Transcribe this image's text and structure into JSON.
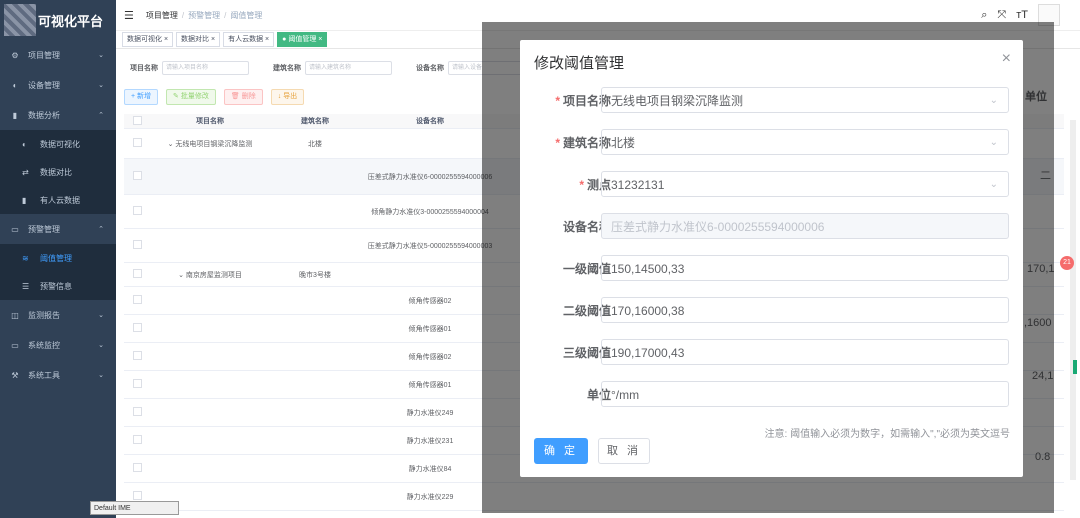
{
  "app": {
    "title": "可视化平台"
  },
  "sidebar": {
    "items": [
      {
        "label": "项目管理",
        "icon": "gear-icon"
      },
      {
        "label": "设备管理",
        "icon": "dashboard-icon"
      },
      {
        "label": "数据分析",
        "icon": "chart-icon"
      }
    ],
    "data_sub": [
      {
        "label": "数据可视化",
        "icon": "dashboard-icon"
      },
      {
        "label": "数据对比",
        "icon": "compare-icon"
      },
      {
        "label": "有人云数据",
        "icon": "chart-icon"
      }
    ],
    "alarm": {
      "label": "预警管理",
      "icon": "monitor-icon"
    },
    "alarm_sub": [
      {
        "label": "阈值管理",
        "icon": "threshold-icon"
      },
      {
        "label": "预警信息",
        "icon": "list-icon"
      }
    ],
    "bottom": [
      {
        "label": "监测报告",
        "icon": "book-icon"
      },
      {
        "label": "系统监控",
        "icon": "monitor-icon"
      },
      {
        "label": "系统工具",
        "icon": "wrench-icon"
      }
    ]
  },
  "breadcrumb": [
    "项目管理",
    "预警管理",
    "阈值管理"
  ],
  "tags": [
    "数据可视化",
    "数据对比",
    "有人云数据",
    "阈值管理"
  ],
  "filters": {
    "project_label": "项目名称",
    "project_ph": "请输入项目名称",
    "building_label": "建筑名称",
    "building_ph": "请输入建筑名称",
    "device_label": "设备名称",
    "device_ph": "请输入设备"
  },
  "toolbar": {
    "add": "新增",
    "batch": "批量修改",
    "delete": "删除",
    "export": "导出"
  },
  "table": {
    "headers": [
      "项目名称",
      "建筑名称",
      "设备名称"
    ],
    "rows": [
      {
        "project": "无线电项目钢梁沉降监测",
        "building": "北楼",
        "device": ""
      },
      {
        "project": "",
        "building": "",
        "device": "压差式静力水准仪6-0000255594000006"
      },
      {
        "project": "",
        "building": "",
        "device": "倾角静力水准仪3-0000255594000004"
      },
      {
        "project": "",
        "building": "",
        "device": "压差式静力水准仪5-0000255594000003"
      },
      {
        "project": "南京房屋监测项目",
        "building": "晚市3号楼",
        "device": ""
      },
      {
        "project": "",
        "building": "",
        "device": "倾角传感器02"
      },
      {
        "project": "",
        "building": "",
        "device": "倾角传感器01"
      },
      {
        "project": "",
        "building": "",
        "device": "倾角传感器02"
      },
      {
        "project": "",
        "building": "",
        "device": "倾角传感器01"
      },
      {
        "project": "",
        "building": "",
        "device": "静力水准仪249"
      },
      {
        "project": "",
        "building": "",
        "device": "静力水准仪231"
      },
      {
        "project": "",
        "building": "",
        "device": "静力水准仪84"
      },
      {
        "project": "",
        "building": "",
        "device": "静力水准仪229"
      }
    ]
  },
  "background_right": {
    "col": "单位",
    "v1": "二",
    "v2": "170,1",
    "v3": ",1600",
    "v4": "24,1",
    "v5": "0.8",
    "badge": "21"
  },
  "dialog": {
    "title": "修改阈值管理",
    "fields": {
      "project_label": "项目名称",
      "project_value": "无线电项目钢梁沉降监测",
      "building_label": "建筑名称",
      "building_value": "北楼",
      "point_label": "测点",
      "point_value": "31232131",
      "device_label": "设备名称",
      "device_value": "压差式静力水准仪6-0000255594000006",
      "level1_label": "一级阈值",
      "level1_value": "150,14500,33",
      "level2_label": "二级阈值",
      "level2_value": "170,16000,38",
      "level3_label": "三级阈值",
      "level3_value": "190,17000,43",
      "unit_label": "单位",
      "unit_value": "°/mm"
    },
    "note": "注意: 阈值输入必须为数字，如需输入\",\"必须为英文逗号",
    "ok": "确 定",
    "cancel": "取 消"
  },
  "ime": "Default IME"
}
